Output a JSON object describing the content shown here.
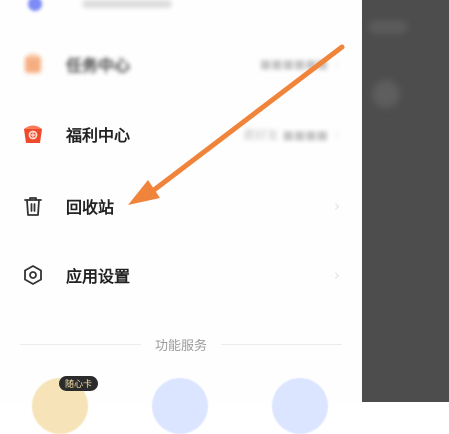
{
  "menu": {
    "items": [
      {
        "label": "任务中心",
        "detail": "■■■■■■",
        "icon": "task-icon"
      },
      {
        "label": "福利中心",
        "detail": "邀好友 ■■■■",
        "icon": "gift-icon"
      },
      {
        "label": "回收站",
        "detail": "",
        "icon": "trash-icon"
      },
      {
        "label": "应用设置",
        "detail": "",
        "icon": "settings-hexagon-icon"
      }
    ]
  },
  "services": {
    "section_title": "功能服务",
    "badge": "随心卡",
    "items": [
      "card-icon",
      "files-icon",
      "cloud-icon"
    ]
  },
  "colors": {
    "arrow": "#f0843a",
    "scrim": "#4d4d4d",
    "task_icon": "#f4a06b",
    "gift_icon": "#f04a2c",
    "service_gold": "#f6e3b7",
    "service_blue": "#dbe5ff"
  }
}
